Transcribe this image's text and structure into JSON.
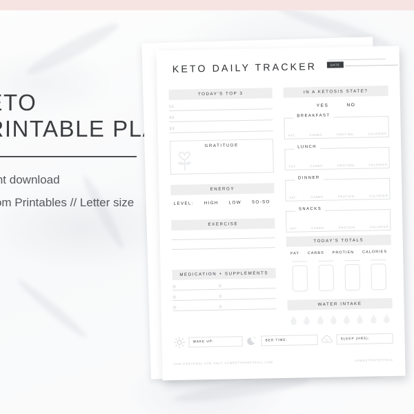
{
  "promo": {
    "title_line1": "KETO",
    "title_line2": "PRINTABLE PLANNER",
    "sub_line1": "Instant download",
    "sub_line2": "Custom Printables // Letter size"
  },
  "planner": {
    "title": "KETO DAILY TRACKER",
    "date_label": "DATE",
    "top3": {
      "heading": "TODAY'S TOP 3",
      "items": [
        "01",
        "02",
        "03"
      ]
    },
    "gratitude": {
      "heading": "GRATITUDE",
      "icon": "heart-flower-icon"
    },
    "energy": {
      "heading": "ENERGY",
      "level_label": "LEVEL:",
      "options": [
        "HIGH",
        "LOW",
        "SO-SO"
      ]
    },
    "exercise": {
      "heading": "EXERCISE"
    },
    "medication": {
      "heading": "MEDICATION + SUPPLEMENTS"
    },
    "ketosis": {
      "heading": "IN A KETOSIS STATE?",
      "yes": "YES",
      "no": "NO"
    },
    "macro_labels": [
      "FAT:",
      "CARBS:",
      "PROTIEN:",
      "CALORIES:"
    ],
    "meals": [
      {
        "name": "BREAKFAST"
      },
      {
        "name": "LUNCH"
      },
      {
        "name": "DINNER"
      },
      {
        "name": "SNACKS"
      }
    ],
    "totals": {
      "heading": "TODAY'S TOTALS",
      "columns": [
        "FAT",
        "CARBS",
        "PROTIEN",
        "CALORIES"
      ]
    },
    "water": {
      "heading": "WATER INTAKE",
      "droplet_count": 8
    },
    "sleep_row": [
      {
        "icon": "sun-icon",
        "label": "WAKE UP:"
      },
      {
        "icon": "moon-icon",
        "label": "BED TIME:"
      },
      {
        "icon": "sleep-cloud-icon",
        "label": "SLEEP (HRS):"
      }
    ],
    "footer": {
      "left": "FOR PERSONAL USE ONLY ©SWEETPAPERTRAIL.COM",
      "right": "#SWEETPAPERTRAIL"
    }
  },
  "colors": {
    "pink_band": "#f6e4e3",
    "section_band": "#eeeeef",
    "ink": "#2f3134",
    "rule": "#dcdee1"
  }
}
